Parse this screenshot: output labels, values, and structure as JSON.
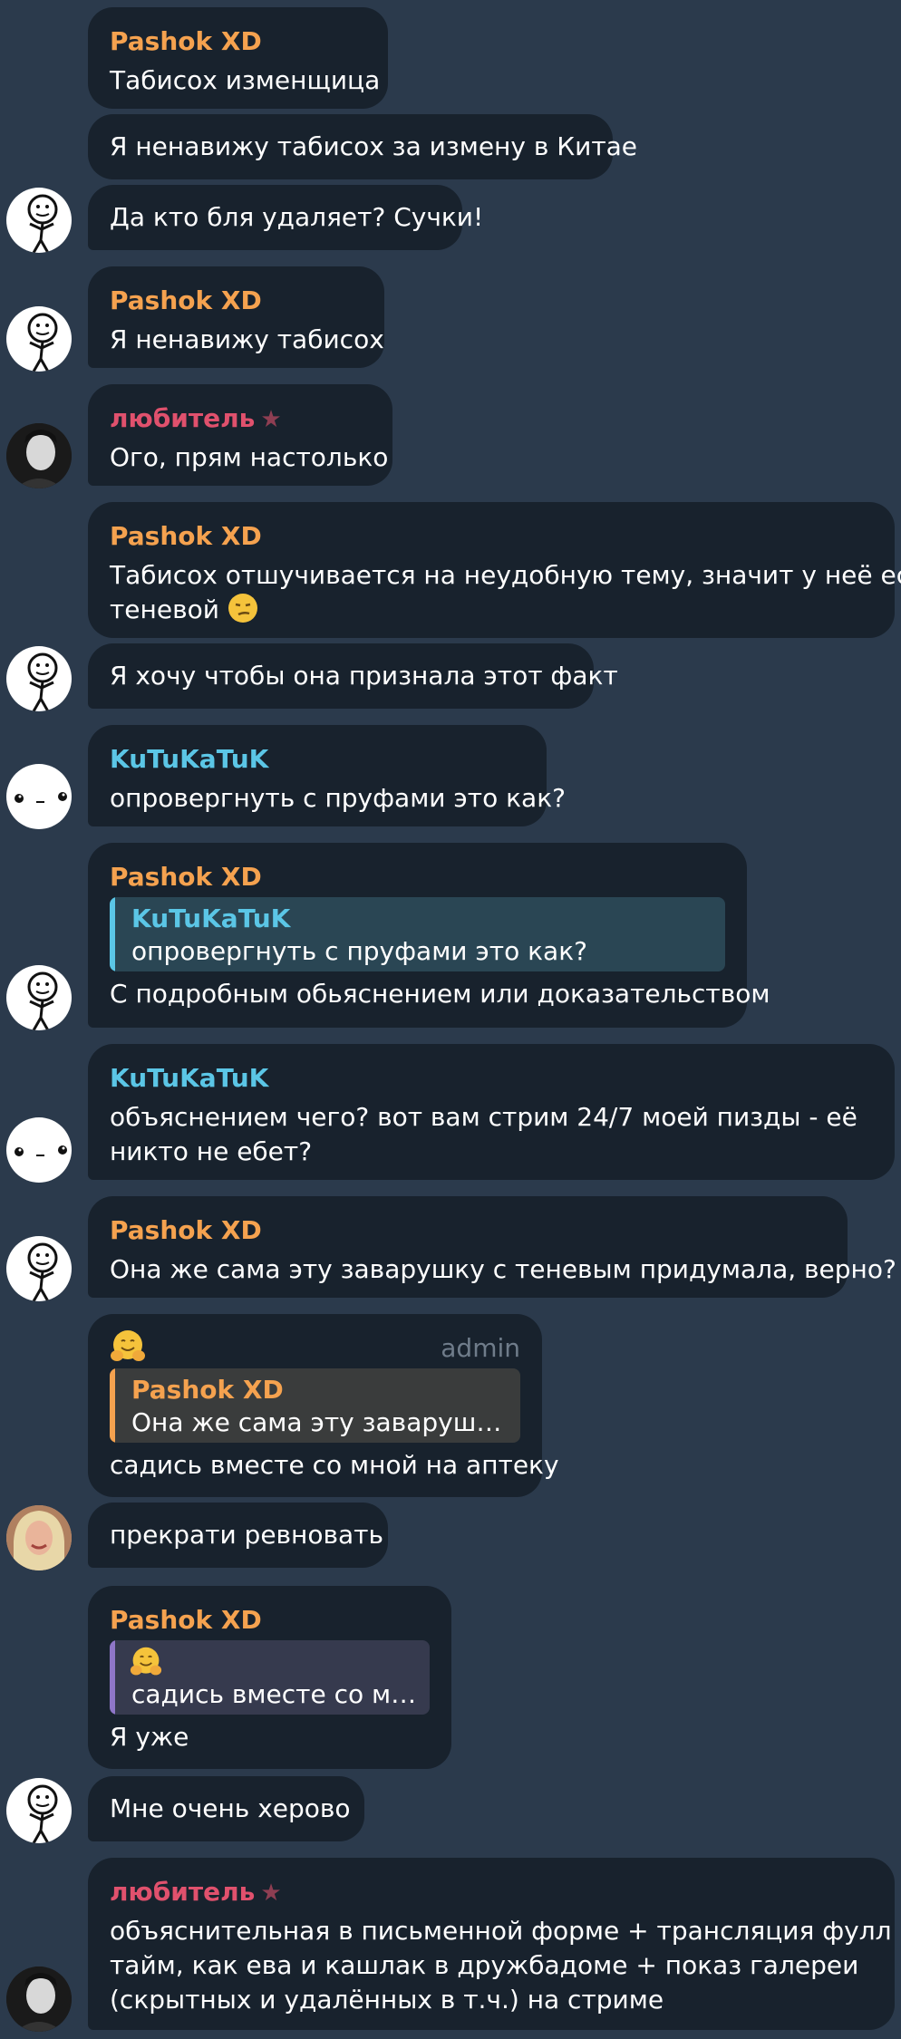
{
  "messages": [
    {
      "sender": "Pashok XD",
      "text": "Табисох изменщица"
    },
    {
      "text": "Я ненавижу табисох за измену в Китае"
    },
    {
      "text": "Да кто бля удаляет? Сучки!"
    },
    {
      "sender": "Pashok XD",
      "text": "Я ненавижу табисох"
    },
    {
      "sender": "любитель",
      "text": "Ого, прям настолько"
    },
    {
      "sender": "Pashok XD",
      "lines": [
        "Табисох отшучивается на неудобную тему, значит у неё есть",
        "теневой"
      ]
    },
    {
      "text": "Я хочу чтобы она признала этот факт"
    },
    {
      "sender": "KuTuKaTuK",
      "text": "опровергнуть с пруфами это как?"
    },
    {
      "sender": "Pashok XD",
      "reply_name": "KuTuKaTuK",
      "reply_text": "опровергнуть с пруфами это как?",
      "text": "С подробным обьяснением или доказательством"
    },
    {
      "sender": "KuTuKaTuK",
      "lines": [
        "объяснением чего? вот вам стрим 24/7 моей пизды - её",
        "никто не ебет?"
      ]
    },
    {
      "sender": "Pashok XD",
      "text": "Она же сама эту заварушку с теневым придумала, верно?"
    },
    {
      "badge": "admin",
      "reply_name": "Pashok XD",
      "reply_text": "Она же сама эту заварушку с...",
      "text": "садись вместе со мной на аптеку"
    },
    {
      "text": "прекрати ревновать"
    },
    {
      "sender": "Pashok XD",
      "reply_text": "садись вместе со мн...",
      "text": "Я уже"
    },
    {
      "text": "Мне очень херово"
    },
    {
      "sender": "любитель",
      "lines": [
        "объяснительная в письменной форме + трансляция фулл",
        "тайм, как ева и кашлак в дружбадоме + показ галереи",
        "(скрытных и удалённых в т.ч.) на стриме"
      ]
    }
  ],
  "colors": {
    "background": "#2b3a4c",
    "bubble": "#18222d",
    "orange": "#f5a24f",
    "pink": "#e0516d",
    "cyan": "#5bc6e6",
    "purple": "#8f76c8"
  }
}
